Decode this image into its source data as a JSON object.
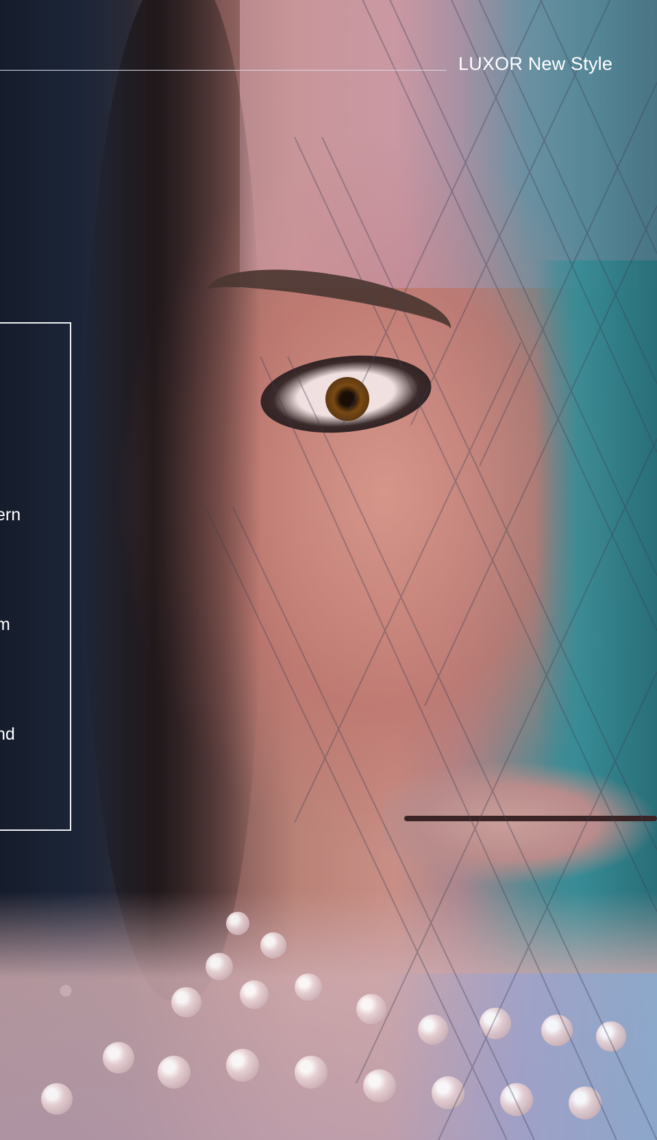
{
  "header": {
    "title": "LUXOR New Style"
  },
  "hero_image": {
    "subject": "close-up of model face with pearl collar"
  },
  "side_panel": {
    "fragment_1": "ern",
    "fragment_2": "m",
    "fragment_3a": "ı",
    "fragment_3b": "nd"
  },
  "colors": {
    "accent_text": "#ffffff",
    "rule": "#d9d9e6",
    "background_dark": "#1b2436"
  }
}
